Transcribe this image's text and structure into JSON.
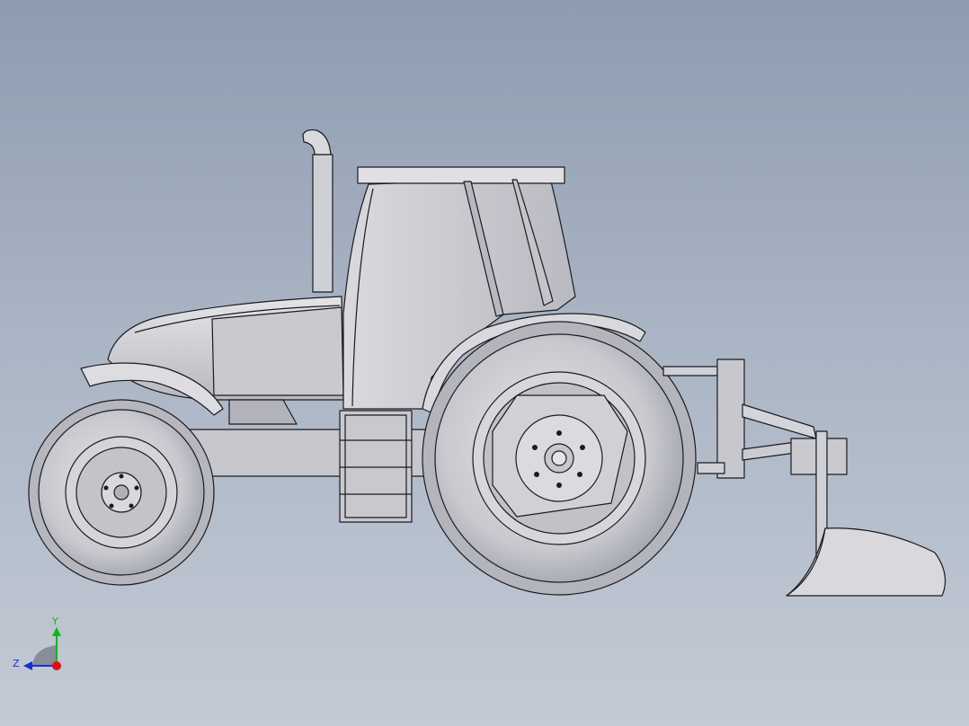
{
  "viewport": {
    "background_top": "#8e9cb0",
    "background_bottom": "#c3cad5"
  },
  "model": {
    "body_color": "#d2d2d6",
    "shade_color": "#b4b5bc",
    "dark_color": "#8d8f97",
    "edge_color": "#1b1b1e"
  },
  "triad": {
    "y_label": "Y",
    "z_label": "Z",
    "y_color": "#13b51a",
    "z_color": "#1530d8",
    "x_color": "#e01010"
  }
}
